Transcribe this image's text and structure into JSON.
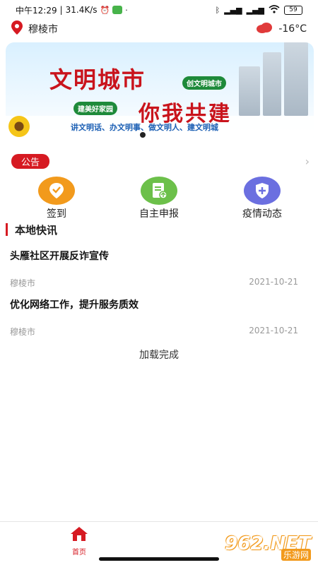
{
  "status_bar": {
    "time": "中午12:29",
    "speed": "31.4K/s",
    "battery": "59"
  },
  "header": {
    "location": "穆棱市",
    "temperature": "-16°C",
    "location_icon": "location-pin-icon",
    "weather_icon": "cloud-icon"
  },
  "banner": {
    "title_1": "文明城市",
    "title_2": "你我共建",
    "chip_1": "创文明城市",
    "chip_2": "建美好家园",
    "slogan": "讲文明话、办文明事、做文明人、建文明城"
  },
  "notice": {
    "label": "公告"
  },
  "quick_actions": [
    {
      "label": "签到",
      "icon": "check-in-icon",
      "color": "#f29a1c"
    },
    {
      "label": "自主申报",
      "icon": "declare-document-icon",
      "color": "#6cc04a"
    },
    {
      "label": "疫情动态",
      "icon": "epidemic-shield-icon",
      "color": "#6b6fe0"
    }
  ],
  "section": {
    "title": "本地快讯"
  },
  "news": [
    {
      "title": "头雁社区开展反诈宣传",
      "source": "穆棱市",
      "date": "2021-10-21"
    },
    {
      "title": "优化网络工作，提升服务质效",
      "source": "穆棱市",
      "date": "2021-10-21"
    }
  ],
  "load_status": "加载完成",
  "bottom_nav": {
    "home_label": "首页"
  },
  "watermark": {
    "logo": "962.NET",
    "sub": "乐游网"
  },
  "colors": {
    "accent": "#d61a22",
    "orange": "#f29a1c",
    "green": "#6cc04a",
    "purple": "#6b6fe0"
  }
}
